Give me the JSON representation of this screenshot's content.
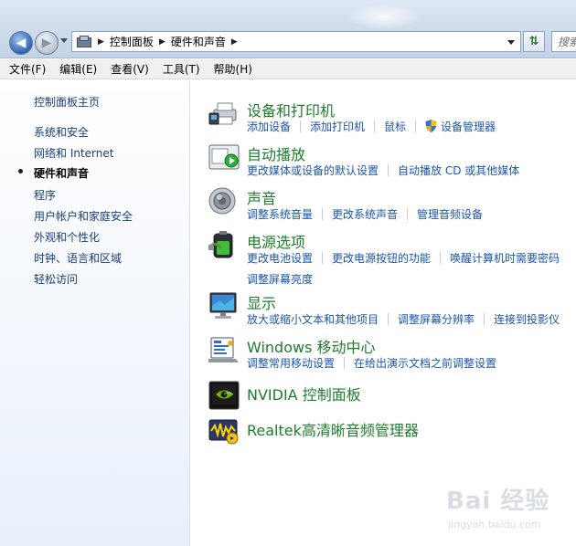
{
  "window": {
    "search_placeholder": "搜索"
  },
  "breadcrumb": [
    {
      "label": "控制面板"
    },
    {
      "label": "硬件和声音"
    }
  ],
  "menu": [
    "文件(F)",
    "编辑(E)",
    "查看(V)",
    "工具(T)",
    "帮助(H)"
  ],
  "sidebar": {
    "items": [
      {
        "label": "控制面板主页",
        "current": false
      },
      {
        "label": "系统和安全",
        "current": false
      },
      {
        "label": "网络和 Internet",
        "current": false
      },
      {
        "label": "硬件和声音",
        "current": true
      },
      {
        "label": "程序",
        "current": false
      },
      {
        "label": "用户帐户和家庭安全",
        "current": false
      },
      {
        "label": "外观和个性化",
        "current": false
      },
      {
        "label": "时钟、语言和区域",
        "current": false
      },
      {
        "label": "轻松访问",
        "current": false
      }
    ]
  },
  "categories": [
    {
      "title": "设备和打印机",
      "icon": "printer-icon",
      "links": [
        [
          "添加设备",
          "添加打印机",
          "鼠标",
          "设备管理器"
        ]
      ]
    },
    {
      "title": "自动播放",
      "icon": "autoplay-icon",
      "links": [
        [
          "更改媒体或设备的默认设置",
          "自动播放 CD 或其他媒体"
        ]
      ]
    },
    {
      "title": "声音",
      "icon": "speaker-icon",
      "links": [
        [
          "调整系统音量",
          "更改系统声音",
          "管理音频设备"
        ]
      ]
    },
    {
      "title": "电源选项",
      "icon": "battery-icon",
      "links": [
        [
          "更改电池设置",
          "更改电源按钮的功能",
          "唤醒计算机时需要密码"
        ],
        [
          "调整屏幕亮度"
        ]
      ]
    },
    {
      "title": "显示",
      "icon": "monitor-icon",
      "links": [
        [
          "放大或缩小文本和其他项目",
          "调整屏幕分辨率",
          "连接到投影仪"
        ]
      ]
    },
    {
      "title": "Windows 移动中心",
      "icon": "mobility-center-icon",
      "links": [
        [
          "调整常用移动设置",
          "在给出演示文档之前调整设置"
        ]
      ]
    },
    {
      "title": "NVIDIA 控制面板",
      "icon": "nvidia-icon",
      "links": []
    },
    {
      "title": "Realtek高清晰音频管理器",
      "icon": "realtek-icon",
      "links": []
    }
  ],
  "watermark": {
    "text": "Bai 经验",
    "sub": "jingyan.baidu.com"
  },
  "colors": {
    "category_title": "#1e7d2c",
    "link": "#1a55b0",
    "sidebar_link": "#1a3e7a"
  }
}
